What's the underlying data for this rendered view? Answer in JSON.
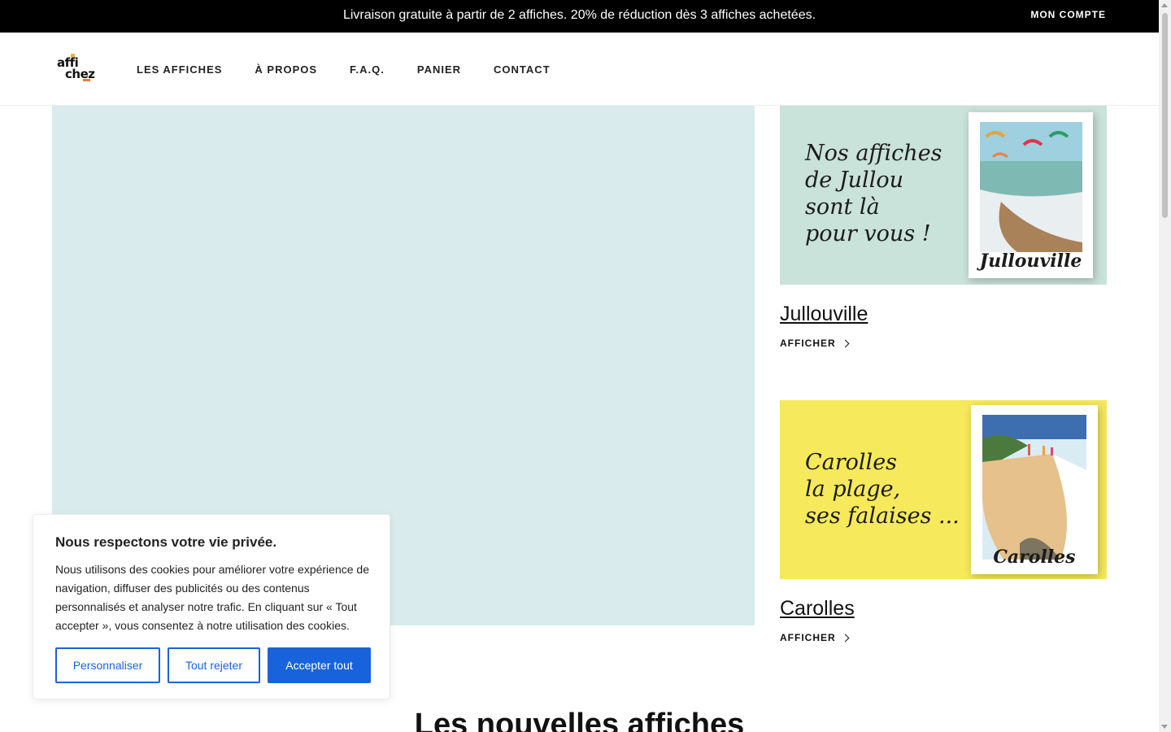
{
  "topbar": {
    "promo": "Livraison gratuite à partir de 2 affiches. 20% de réduction dès 3 affiches achetées.",
    "account": "MON COMPTE"
  },
  "header": {
    "logo_line1": "affi",
    "logo_line2": "chez",
    "nav": [
      "LES AFFICHES",
      "À PROPOS",
      "F.A.Q.",
      "PANIER",
      "CONTACT"
    ]
  },
  "cards": [
    {
      "banner_text": "Nos affiches\nde Jullou\nsont là\npour vous !",
      "poster_name": "Jullouville",
      "title": "Jullouville",
      "link": "AFFICHER",
      "banner_color": "#c9e2da"
    },
    {
      "banner_text": "Carolles\nla plage,\nses falaises ...",
      "poster_name": "Carolles",
      "title": "Carolles",
      "link": "AFFICHER",
      "banner_color": "#f6e95c"
    }
  ],
  "section": {
    "title": "Les nouvelles affiches"
  },
  "cookie": {
    "title": "Nous respectons votre vie privée.",
    "text": "Nous utilisons des cookies pour améliorer votre expérience de navigation, diffuser des publicités ou des contenus personnalisés et analyser notre trafic. En cliquant sur « Tout accepter », vous consentez à notre utilisation des cookies.",
    "customize": "Personnaliser",
    "reject": "Tout rejeter",
    "accept": "Accepter tout",
    "accent_color": "#1863dc"
  },
  "colors": {
    "hero_bg": "#d9ebec",
    "topbar_bg": "#000000"
  }
}
